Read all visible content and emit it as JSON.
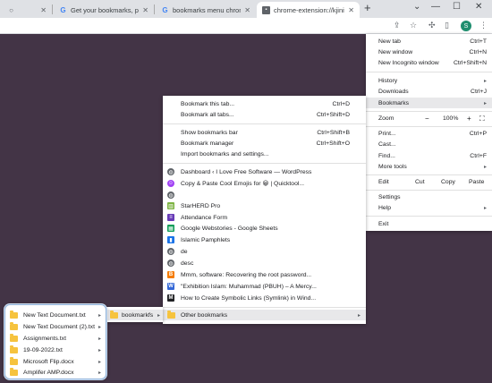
{
  "tabs": [
    {
      "title": "",
      "close": "✕"
    },
    {
      "title": "Get your bookmarks, pass",
      "close": "✕"
    },
    {
      "title": "bookmarks menu chrome",
      "close": "✕"
    },
    {
      "title": "chrome-extension://kjinifj",
      "close": "✕"
    }
  ],
  "new_tab_symbol": "+",
  "window_controls": {
    "chevron": "⌄",
    "minimize": "—",
    "maximize": "☐",
    "close": "✕"
  },
  "profile_initial": "S",
  "main_menu": {
    "new_tab": {
      "label": "New tab",
      "shortcut": "Ctrl+T"
    },
    "new_window": {
      "label": "New window",
      "shortcut": "Ctrl+N"
    },
    "new_incognito": {
      "label": "New Incognito window",
      "shortcut": "Ctrl+Shift+N"
    },
    "history": {
      "label": "History"
    },
    "downloads": {
      "label": "Downloads",
      "shortcut": "Ctrl+J"
    },
    "bookmarks": {
      "label": "Bookmarks"
    },
    "zoom": {
      "label": "Zoom",
      "minus": "−",
      "value": "100%",
      "plus": "+"
    },
    "print": {
      "label": "Print...",
      "shortcut": "Ctrl+P"
    },
    "cast": {
      "label": "Cast..."
    },
    "find": {
      "label": "Find...",
      "shortcut": "Ctrl+F"
    },
    "more_tools": {
      "label": "More tools"
    },
    "edit": {
      "label": "Edit",
      "cut": "Cut",
      "copy": "Copy",
      "paste": "Paste"
    },
    "settings": {
      "label": "Settings"
    },
    "help": {
      "label": "Help"
    },
    "exit": {
      "label": "Exit"
    }
  },
  "bookmarks_menu": {
    "bookmark_tab": {
      "label": "Bookmark this tab...",
      "shortcut": "Ctrl+D"
    },
    "bookmark_all": {
      "label": "Bookmark all tabs...",
      "shortcut": "Ctrl+Shift+D"
    },
    "show_bar": {
      "label": "Show bookmarks bar",
      "shortcut": "Ctrl+Shift+B"
    },
    "manager": {
      "label": "Bookmark manager",
      "shortcut": "Ctrl+Shift+O"
    },
    "import": {
      "label": "Import bookmarks and settings..."
    },
    "items": [
      {
        "label": "Dashboard ‹ I Love Free Software — WordPress",
        "icon": "globe",
        "color": "#5f6368"
      },
      {
        "label": "Copy & Paste Cool Emojis for 😀 | Quicktool...",
        "icon": "emoji",
        "color": "#a142f4"
      },
      {
        "label": "",
        "icon": "globe",
        "color": "#5f6368"
      },
      {
        "label": "StarHERD Pro",
        "icon": "herd",
        "color": "#7cb342"
      },
      {
        "label": "Attendance Form",
        "icon": "form",
        "color": "#673ab7"
      },
      {
        "label": "Google Webstories - Google Sheets",
        "icon": "sheets",
        "color": "#0f9d58"
      },
      {
        "label": "Islamic Pamphlets",
        "icon": "book",
        "color": "#1a73e8"
      },
      {
        "label": "de",
        "icon": "globe",
        "color": "#5f6368"
      },
      {
        "label": "desc",
        "icon": "globe",
        "color": "#5f6368"
      },
      {
        "label": "Mmm, software: Recovering the root password...",
        "icon": "blogger",
        "color": "#f57c00"
      },
      {
        "label": "\"Exhibition Islam: Muhammad (PBUH) – A Mercy...",
        "icon": "w",
        "color": "#3367d6"
      },
      {
        "label": "How to Create Symbolic Links (Symlink) in Wind...",
        "icon": "m",
        "color": "#202124"
      }
    ],
    "other_bookmarks": {
      "label": "Other bookmarks"
    }
  },
  "bookmarkfs_label": "bookmarkfs",
  "files": [
    {
      "label": "New Text Document.txt"
    },
    {
      "label": "New Text Document (2).txt"
    },
    {
      "label": "Assignments.txt"
    },
    {
      "label": "19-09-2022.txt"
    },
    {
      "label": "Microsoft Flip.docx"
    },
    {
      "label": "Amplifer AMP.docx"
    }
  ],
  "submenu_arrow": "▸",
  "colors": {
    "page_bg": "#433446",
    "accent_blue": "#1a73e8",
    "highlight": "#e8e8ea",
    "folder": "#f6c33e"
  }
}
